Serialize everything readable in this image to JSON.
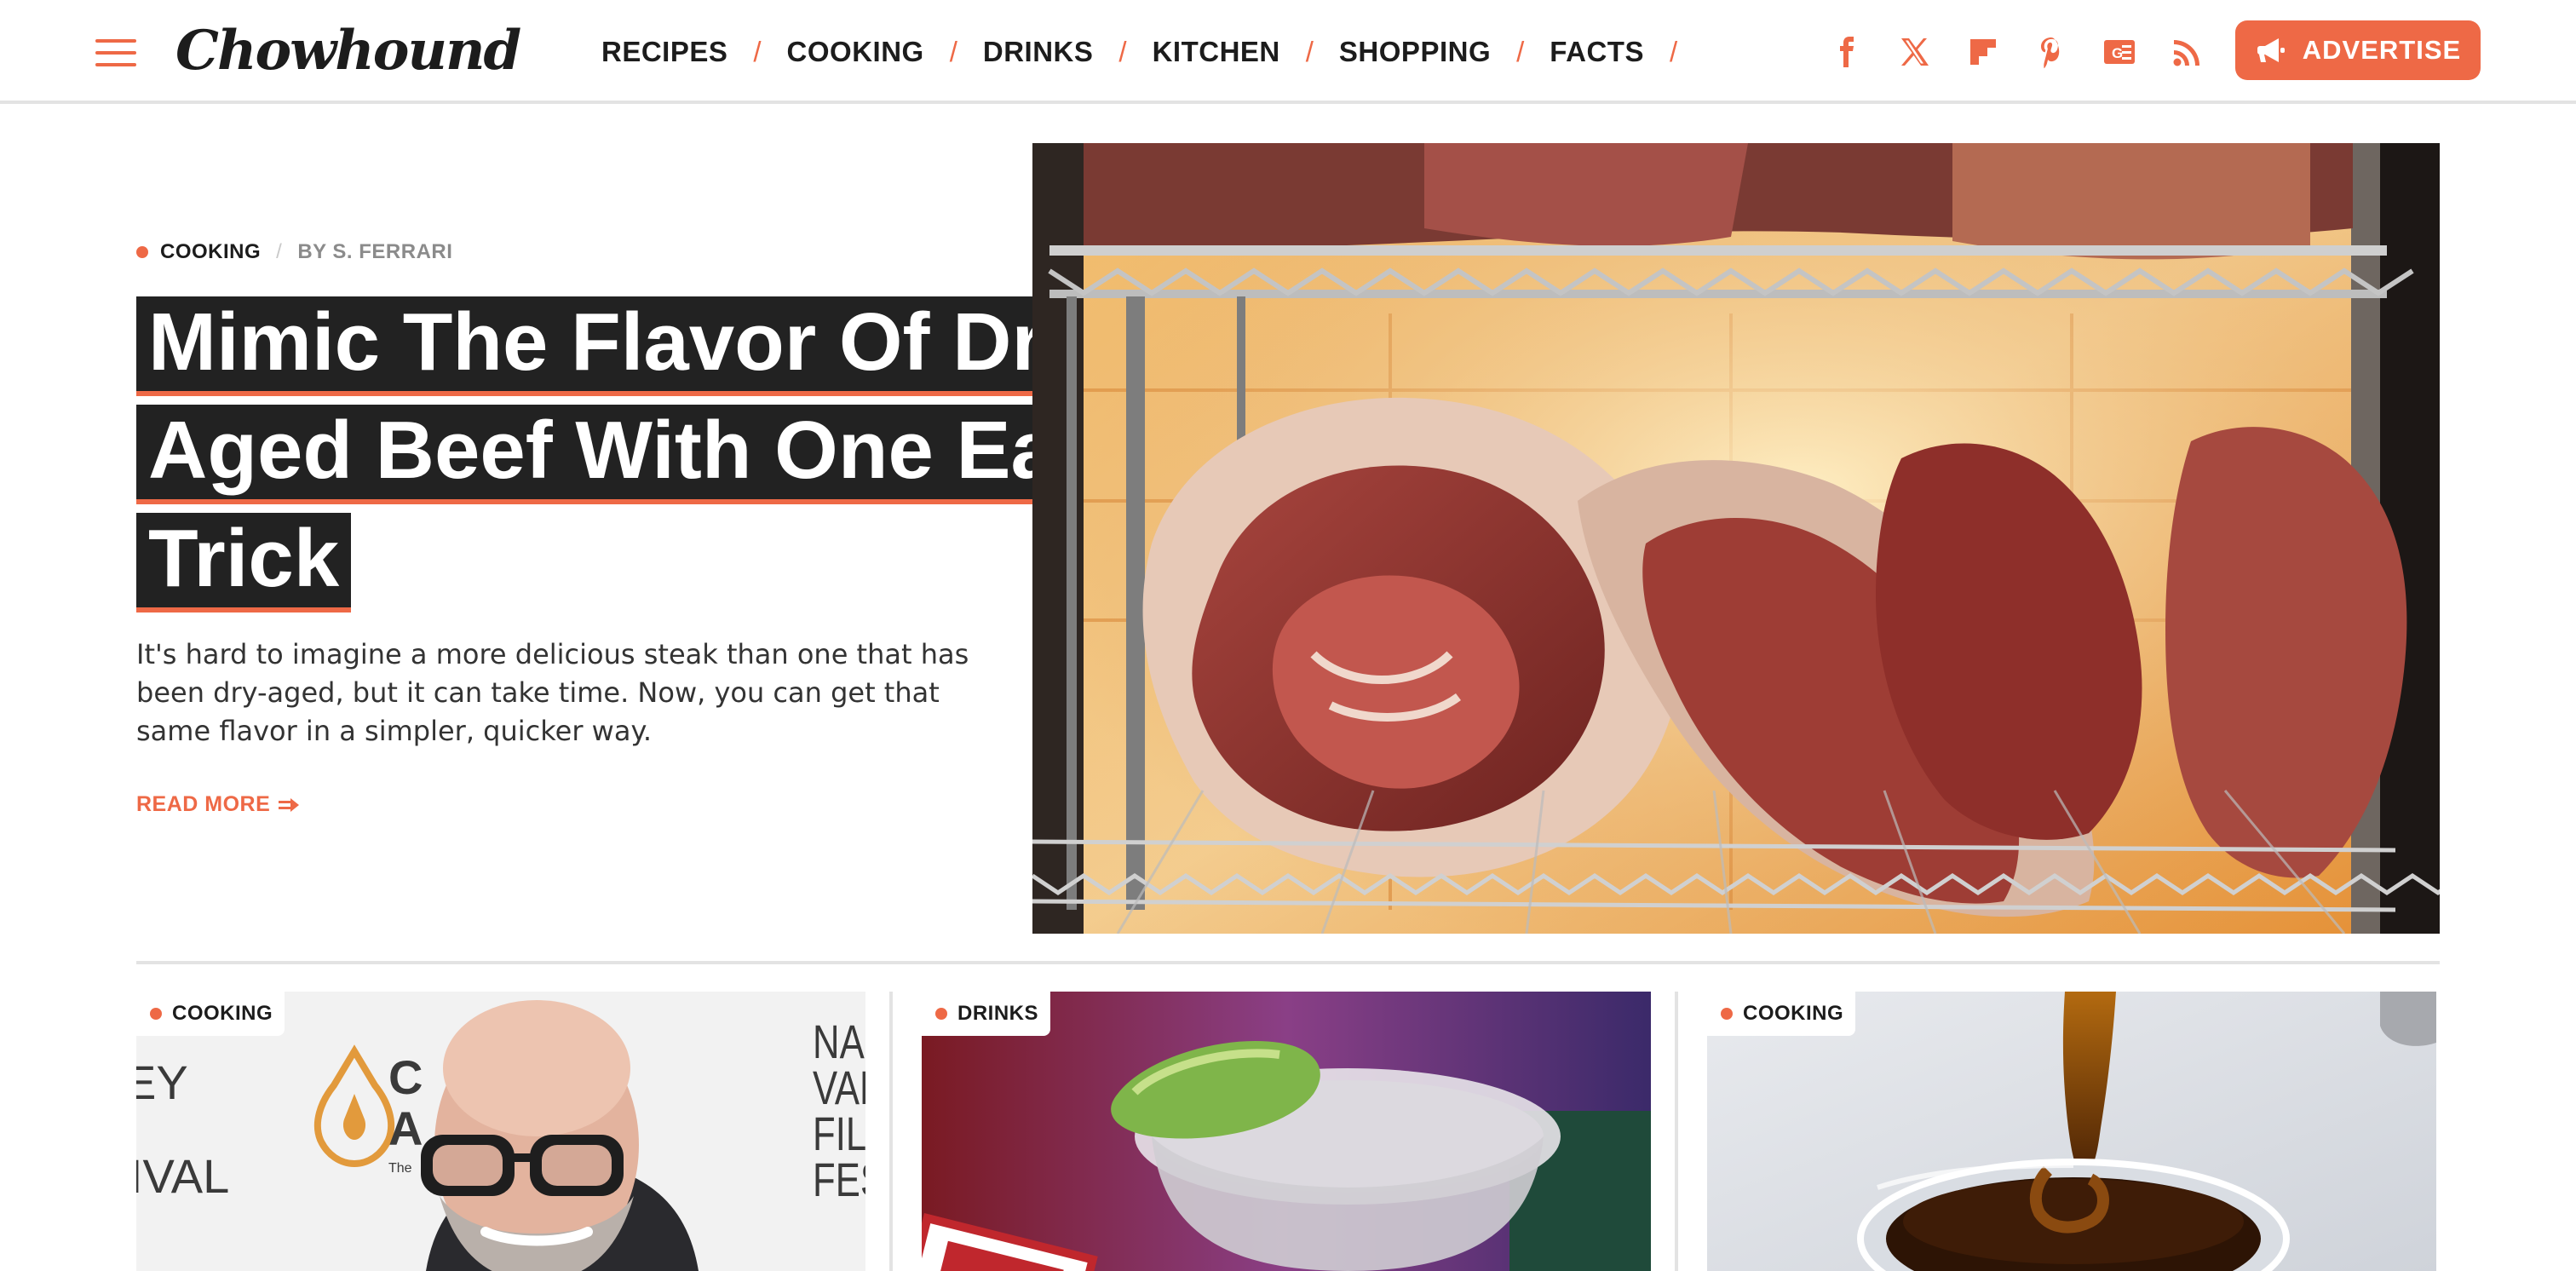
{
  "header": {
    "logo": "Chowhound",
    "nav": [
      {
        "label": "RECIPES"
      },
      {
        "label": "COOKING"
      },
      {
        "label": "DRINKS"
      },
      {
        "label": "KITCHEN"
      },
      {
        "label": "SHOPPING"
      },
      {
        "label": "FACTS"
      }
    ],
    "nav_separator": "/",
    "social_icons": [
      "facebook-icon",
      "x-icon",
      "flipboard-icon",
      "pinterest-icon",
      "google-news-icon",
      "rss-icon"
    ],
    "advertise_label": "ADVERTISE"
  },
  "hero": {
    "category": "COOKING",
    "separator": "/",
    "author": "BY S. FERRARI",
    "title": "Mimic The Flavor Of Dry-Aged Beef With One Easy Trick",
    "description": "It's hard to imagine a more delicious steak than one that has been dry-aged, but it can take time. Now, you can get that same flavor in a simpler, quicker way.",
    "read_more": "READ MORE",
    "read_more_icon": "arrow-right-icon"
  },
  "cards": [
    {
      "category": "COOKING",
      "image_text": [
        "NAPA",
        "VALLEY",
        "FILM",
        "FESTIV"
      ],
      "image_text_left": [
        "EY",
        "IVAL"
      ]
    },
    {
      "category": "DRINKS"
    },
    {
      "category": "COOKING"
    }
  ],
  "colors": {
    "accent": "#ee6946",
    "dark": "#222222",
    "divider": "#e3e3e3"
  }
}
